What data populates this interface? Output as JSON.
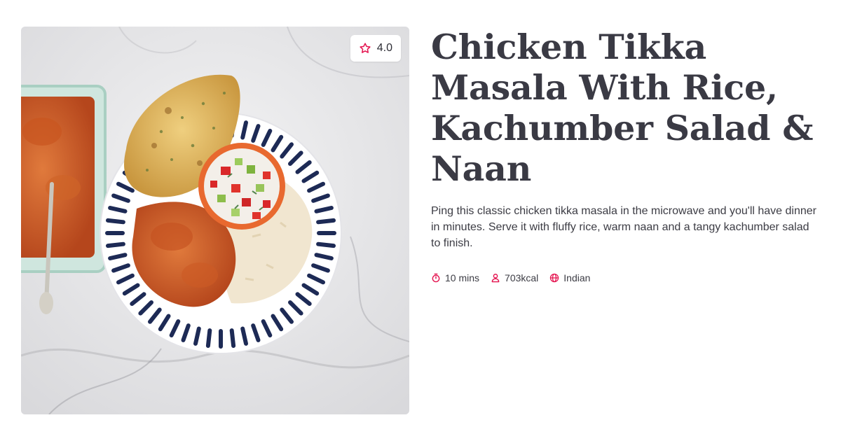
{
  "recipe": {
    "rating": "4.0",
    "title": "Chicken Tikka Masala With Rice, Kachumber Salad & Naan",
    "description": "Ping this classic chicken tikka masala in the microwave and you'll have dinner in minutes. Serve it with fluffy rice, warm naan and a tangy kachumber salad to finish.",
    "time": "10 mins",
    "calories": "703kcal",
    "cuisine": "Indian"
  },
  "icons": {
    "rating": "star-outline-icon",
    "time": "stopwatch-icon",
    "calories": "person-icon",
    "cuisine": "globe-icon"
  },
  "colors": {
    "accent": "#e4134f",
    "title": "#3a3a44",
    "text": "#3c3c44"
  }
}
